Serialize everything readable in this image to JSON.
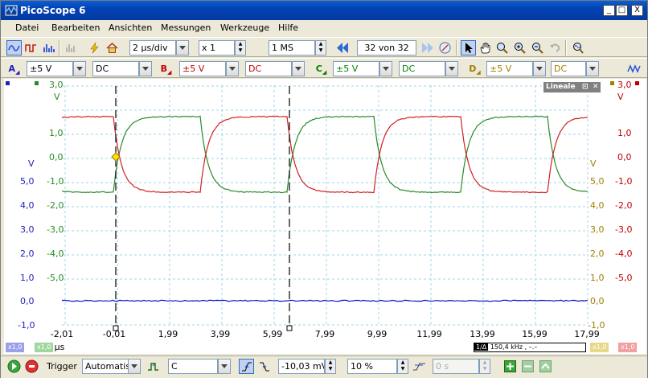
{
  "window": {
    "title": "PicoScope 6",
    "min": "_",
    "max": "□",
    "close": "X"
  },
  "menu": [
    "Datei",
    "Bearbeiten",
    "Ansichten",
    "Messungen",
    "Werkzeuge",
    "Hilfe"
  ],
  "toolbar1": {
    "timebase": "2 µs/div",
    "zoom": "x 1",
    "samples": "1 MS",
    "buffer": "32 von 32"
  },
  "channels": [
    {
      "name": "A",
      "range": "±5 V",
      "coupling": "DC",
      "color": "#2020c0"
    },
    {
      "name": "B",
      "range": "±5 V",
      "coupling": "DC",
      "color": "#c00000"
    },
    {
      "name": "C",
      "range": "±5 V",
      "coupling": "DC",
      "color": "#008000"
    },
    {
      "name": "D",
      "range": "±5 V",
      "coupling": "DC",
      "color": "#a08000"
    }
  ],
  "axes": {
    "left_green": [
      "3,0",
      "V",
      "1,0",
      "0,0",
      "-1,0",
      "-2,0",
      "-3,0",
      "-4,0",
      "-5,0"
    ],
    "left_blue": [
      "V",
      "5,0",
      "4,0",
      "3,0",
      "2,0",
      "1,0",
      "0,0",
      "-1,0"
    ],
    "right_red": [
      "3,0",
      "V",
      "1,0",
      "0,0",
      "-1,0",
      "-2,0",
      "-3,0",
      "-4,0",
      "-5,0"
    ],
    "right_gold": [
      "V",
      "5,0",
      "4,0",
      "3,0",
      "2,0",
      "1,0",
      "0,0",
      "-1,0"
    ],
    "x": [
      "-2,01",
      "-0,01",
      "1,99",
      "3,99",
      "5,99",
      "7,99",
      "9,99",
      "11,99",
      "13,99",
      "15,99",
      "17,99"
    ],
    "x_unit": "µs"
  },
  "lineale": {
    "title": "Lineale",
    "freq": "150,4 kHz , –.–",
    "marker": "1/Δ"
  },
  "scale_chips": [
    "x1,0",
    "x1,0",
    "x1,0",
    "x1,0"
  ],
  "status": {
    "trigger_label": "Trigger",
    "trigger_mode": "Automatisch",
    "trigger_channel": "C",
    "level": "-10,03 mV",
    "pretrigger": "10 %",
    "delay": "0 s"
  }
}
